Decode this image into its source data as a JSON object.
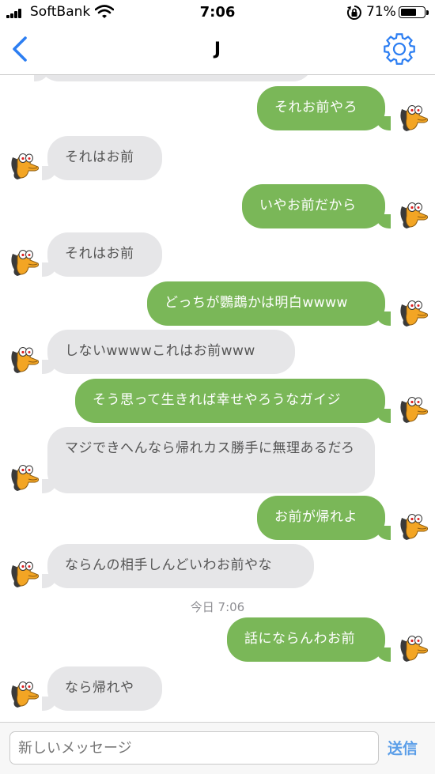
{
  "status_bar": {
    "carrier": "SoftBank",
    "time": "7:06",
    "battery_percent": "71%",
    "battery_level": 0.71,
    "icons": [
      "signal-icon",
      "wifi-icon",
      "orientation-lock-icon",
      "battery-icon"
    ]
  },
  "nav": {
    "title": "J",
    "back_icon": "chevron-left-icon",
    "settings_icon": "gear-icon",
    "accent_color": "#2c7ef2"
  },
  "colors": {
    "outgoing_bubble": "#7ab758",
    "incoming_bubble": "#e6e6e8",
    "outgoing_text": "#ffffff",
    "incoming_text": "#555555"
  },
  "messages": [
    {
      "dir": "out",
      "text": "それお前やろ"
    },
    {
      "dir": "in",
      "text": "それはお前"
    },
    {
      "dir": "out",
      "text": "いやお前だから"
    },
    {
      "dir": "in",
      "text": "それはお前"
    },
    {
      "dir": "out",
      "text": "どっちが鸚鵡かは明白wwww"
    },
    {
      "dir": "in",
      "text": "しないwwwwこれはお前www"
    },
    {
      "dir": "out",
      "text": "そう思って生きれば幸せやろうなガイジ"
    },
    {
      "dir": "in",
      "text": "マジできへんなら帰れカス勝手に無理あるだろ"
    },
    {
      "dir": "out",
      "text": "お前が帰れよ"
    },
    {
      "dir": "in",
      "text": "ならんの相手しんどいわお前やな"
    },
    {
      "dir": "out",
      "text": "話にならんわお前"
    },
    {
      "dir": "in",
      "text": "なら帰れや"
    }
  ],
  "timestamp": "今日 7:06",
  "composer": {
    "placeholder": "新しいメッセージ",
    "send_label": "送信"
  }
}
